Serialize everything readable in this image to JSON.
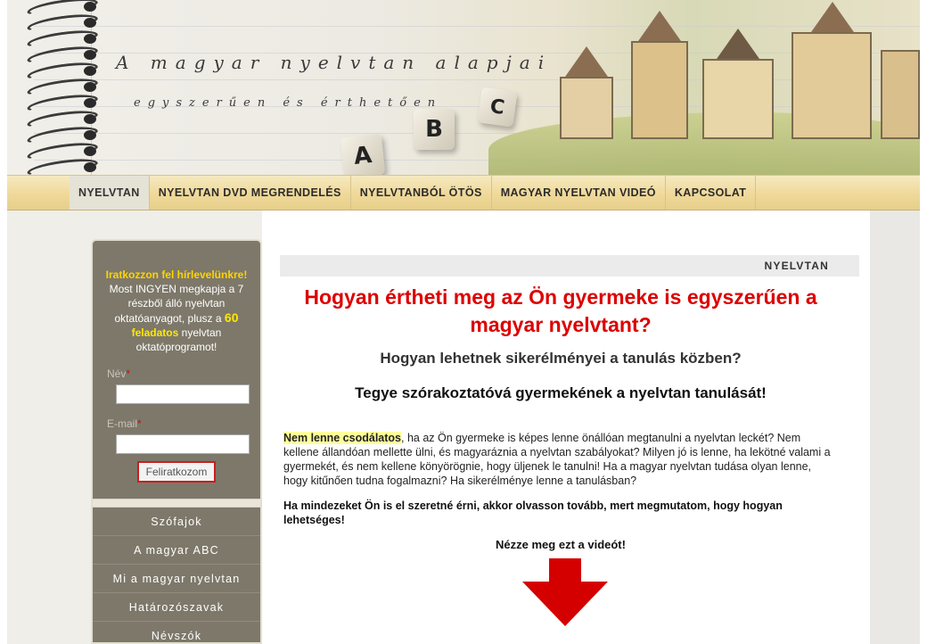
{
  "header": {
    "title": "A magyar nyelvtan alapjai",
    "subtitle": "egyszerűen és érthetően",
    "cubes": [
      "A",
      "B",
      "C"
    ]
  },
  "nav": {
    "items": [
      {
        "label": "NYELVTAN",
        "active": true
      },
      {
        "label": "NYELVTAN DVD MEGRENDELÉS",
        "active": false
      },
      {
        "label": "NYELVTANBÓL ÖTÖS",
        "active": false
      },
      {
        "label": "MAGYAR NYELVTAN VIDEÓ",
        "active": false
      },
      {
        "label": "KAPCSOLAT",
        "active": false
      }
    ]
  },
  "newsletter": {
    "headline": "Iratkozzon fel hírlevelünkre!",
    "line1": "Most INGYEN megkapja a 7 részből álló nyelvtan oktatóanyagot, plusz a",
    "big_number": "60",
    "yellow_word": "feladatos",
    "line2": "nyelvtan oktatóprogramot!",
    "name_label": "Név",
    "email_label": "E-mail",
    "required_mark": "*",
    "name_value": "",
    "email_value": "",
    "submit_label": "Feliratkozom"
  },
  "side_menu": {
    "items": [
      "Szófajok",
      "A magyar ABC",
      "Mi a magyar nyelvtan",
      "Határozószavak",
      "Névszók"
    ]
  },
  "content": {
    "breadcrumb": "NYELVTAN",
    "headline": "Hogyan értheti meg az Ön gyermeke is egyszerűen a magyar nyelvtant?",
    "subheading1": "Hogyan lehetnek sikerélményei a tanulás közben?",
    "subheading2": "Tegye szórakoztatóvá gyermekének a nyelvtan tanulását!",
    "para_highlight": "Nem lenne csodálatos",
    "para_rest": ", ha az Ön gyermeke is képes lenne önállóan megtanulni a nyelvtan leckét? Nem kellene állandóan mellette ülni, és magyaráznia a nyelvtan szabályokat? Milyen jó is lenne, ha lekötné valami a gyermekét, és nem kellene könyörögnie, hogy üljenek le tanulni! Ha a magyar nyelvtan tudása olyan lenne, hogy kitűnően tudna fogalmazni? Ha sikerélménye lenne a tanulásban?",
    "para_bold": "Ha mindezeket Ön is el szeretné érni, akkor olvasson tovább, mert megmutatom, hogy hogyan lehetséges!",
    "video_cta": "Nézze meg ezt a videót!"
  },
  "colors": {
    "headline_red": "#dd0000",
    "highlight_yellow": "#ffff99",
    "sidebar_bg": "#7d786a",
    "nav_gold": "#efd99a",
    "arrow_red": "#d40000"
  }
}
